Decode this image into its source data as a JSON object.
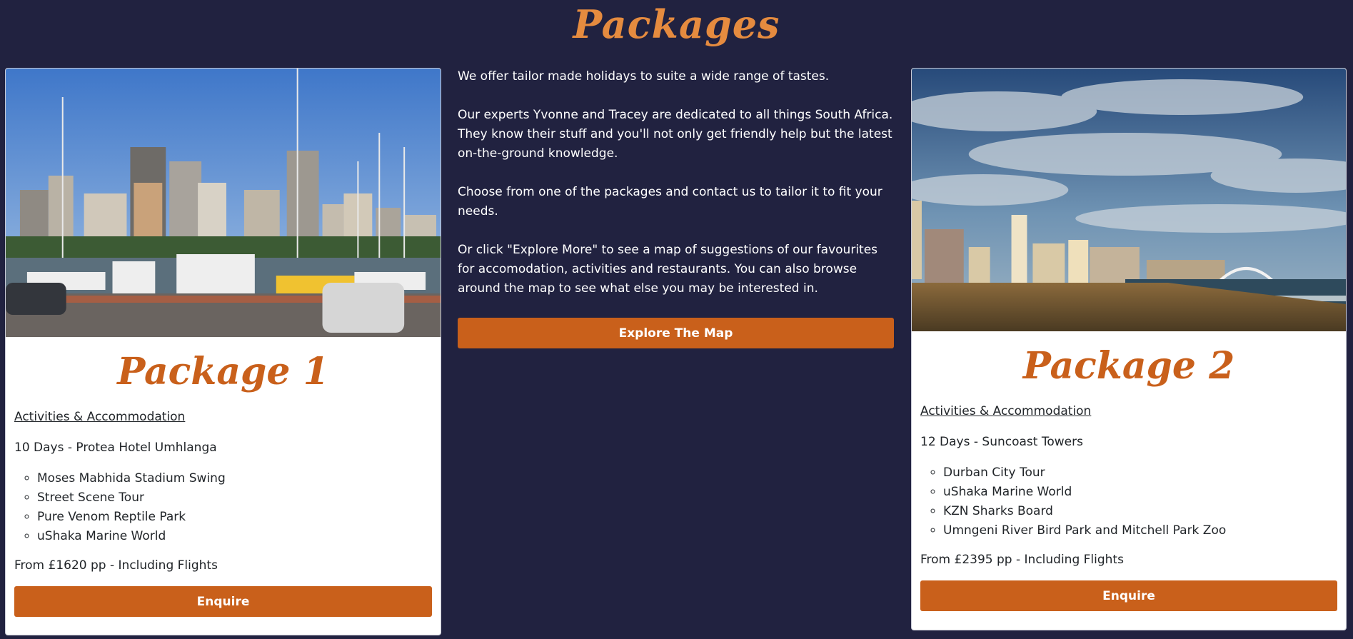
{
  "heading": "Packages",
  "intro": {
    "paragraphs": [
      "We offer tailor made holidays to suite a wide range of tastes.",
      "Our experts Yvonne and Tracey are dedicated to all things South Africa. They know their stuff and you'll not only get friendly help but the latest on-the-ground knowledge.",
      "Choose from one of the packages and contact us to tailor it to fit your needs.",
      "Or click \"Explore More\" to see a map of suggestions of our favourites for accomodation, activities and restaurants. You can also browse around the map to see what else you may be interested in."
    ],
    "explore_label": "Explore The Map"
  },
  "packages": [
    {
      "title": "Package 1",
      "section": "Activities & Accommodation",
      "duration": "10 Days - Protea Hotel Umhlanga",
      "activities": [
        "Moses Mabhida Stadium Swing",
        "Street Scene Tour",
        "Pure Venom Reptile Park",
        "uShaka Marine World"
      ],
      "price": "From £1620 pp - Including Flights",
      "enquire_label": "Enquire"
    },
    {
      "title": "Package 2",
      "section": "Activities & Accommodation",
      "duration": "12 Days - Suncoast Towers",
      "activities": [
        "Durban City Tour",
        "uShaka Marine World",
        "KZN Sharks Board",
        "Umngeni River Bird Park and Mitchell Park Zoo"
      ],
      "price": "From £2395 pp - Including Flights",
      "enquire_label": "Enquire"
    }
  ],
  "colors": {
    "background": "#212240",
    "accent": "#c9601b",
    "heading": "#e58b3f"
  }
}
